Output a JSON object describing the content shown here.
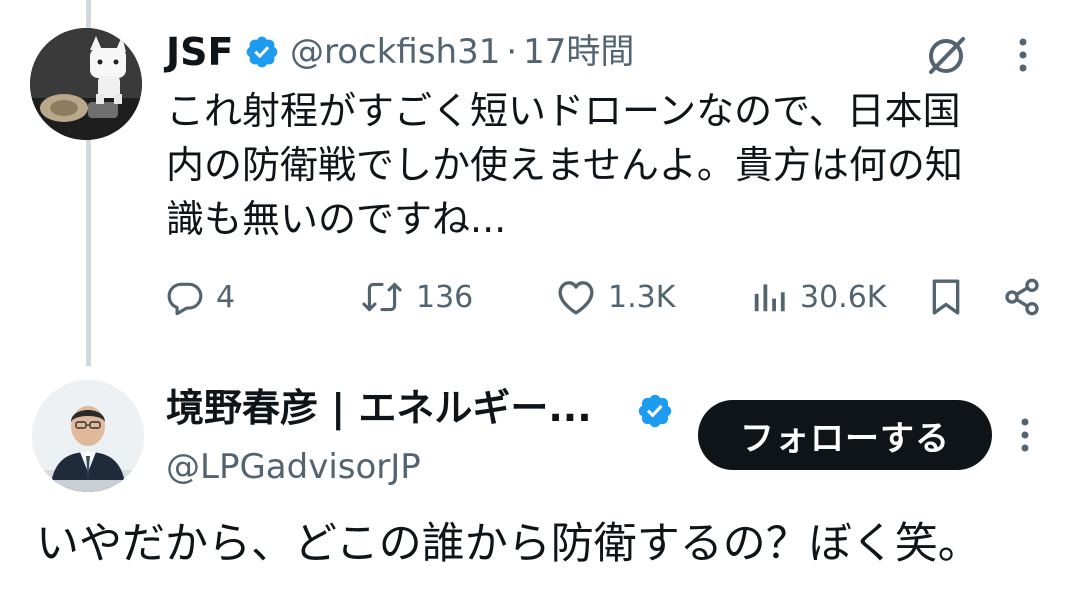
{
  "tweet": {
    "author_name": "JSF",
    "handle": "@rockfish31",
    "separator": "·",
    "time": "17時間",
    "text_lines": [
      "これ射程がすごく短いドローンなので、日本国",
      "内の防衛戦でしか使えませんよ。貴方は何の知",
      "識も無いのですね..."
    ],
    "stats": {
      "replies": "4",
      "reposts": "136",
      "likes": "1.3K",
      "views": "30.6K"
    },
    "icons": [
      "grok-icon",
      "more-icon",
      "reply-icon",
      "repost-icon",
      "like-icon",
      "views-icon",
      "bookmark-icon",
      "share-icon"
    ]
  },
  "reply": {
    "author_name": "境野春彦 | エネルギー...",
    "handle": "@LPGadvisorJP",
    "follow_label": "フォローする",
    "text": "いやだから、どこの誰から防衛するの？ぼく笑。"
  },
  "colors": {
    "verified_blue": "#1d9bf0",
    "secondary_text": "#536471",
    "primary_text": "#0f1419",
    "thread_line": "#cfd9de"
  }
}
